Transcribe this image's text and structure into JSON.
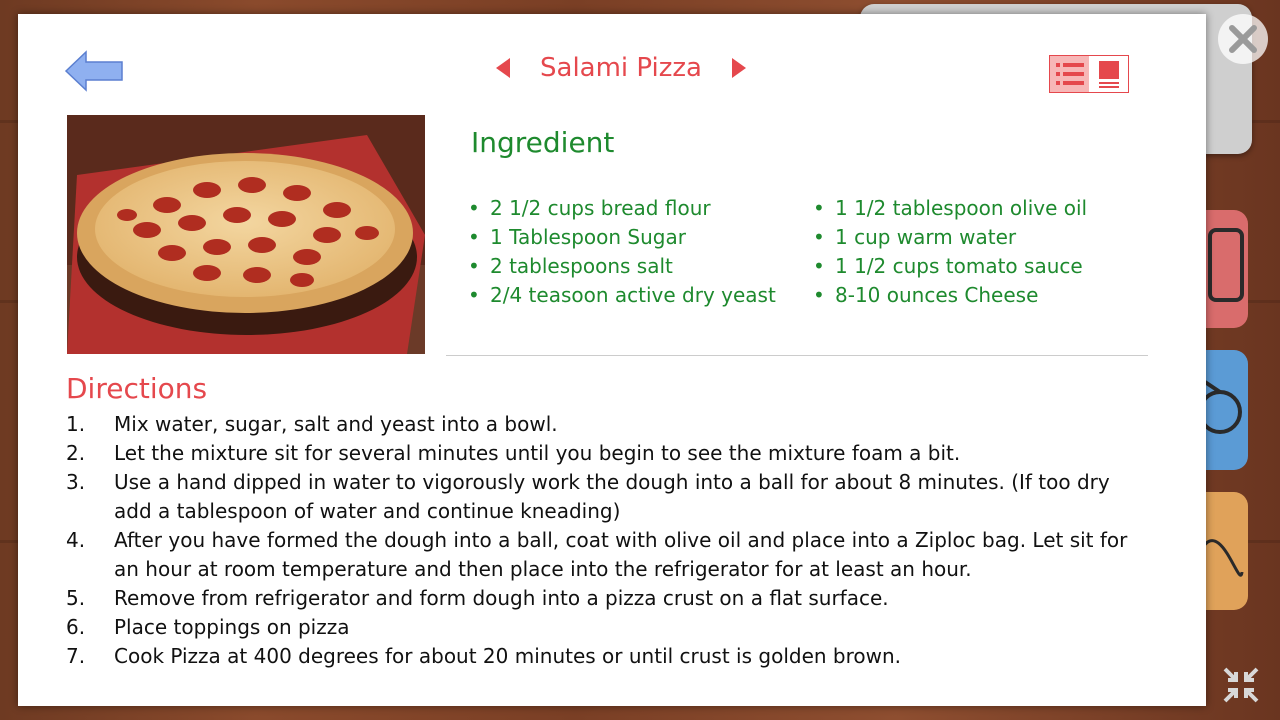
{
  "recipe": {
    "title": "Salami Pizza"
  },
  "ingredients": {
    "heading": "Ingredient",
    "left": [
      "2 1/2 cups bread flour",
      "1 Tablespoon Sugar",
      "2 tablespoons salt",
      "2/4 teasoon active dry yeast"
    ],
    "right": [
      "1 1/2 tablespoon olive oil",
      "1 cup warm water",
      "1 1/2 cups tomato sauce",
      "8-10 ounces Cheese"
    ]
  },
  "directions": {
    "heading": "Directions",
    "steps": [
      {
        "num": "1.",
        "text": "Mix water, sugar, salt and yeast into a bowl."
      },
      {
        "num": "2.",
        "text": "Let the mixture sit for several minutes until you begin to see the mixture foam a bit."
      },
      {
        "num": "3.",
        "text": "Use a hand dipped in water to vigorously work the dough into a ball for about 8 minutes.  (If too dry add a tablespoon of water and continue kneading)"
      },
      {
        "num": "4.",
        "text": "After you have formed the dough into a ball, coat with olive oil and place into a Ziploc bag. Let sit for an hour at room temperature and then place into the refrigerator for at least an hour."
      },
      {
        "num": "5.",
        "text": "Remove from refrigerator and form dough into a pizza crust on a flat surface."
      },
      {
        "num": "6.",
        "text": "Place toppings on pizza"
      },
      {
        "num": "7.",
        "text": "Cook Pizza at 400 degrees for about 20 minutes or until crust is golden brown."
      }
    ]
  },
  "icons": {
    "back": "back-arrow-icon",
    "prev": "prev-triangle-icon",
    "next": "next-triangle-icon",
    "list_view": "list-view-icon",
    "page_view": "page-view-icon",
    "close": "close-icon",
    "shrink": "shrink-icon"
  },
  "colors": {
    "accent_red": "#e5484d",
    "ingredient_green": "#1e8a2e",
    "back_arrow_blue": "#8fb0f0"
  }
}
